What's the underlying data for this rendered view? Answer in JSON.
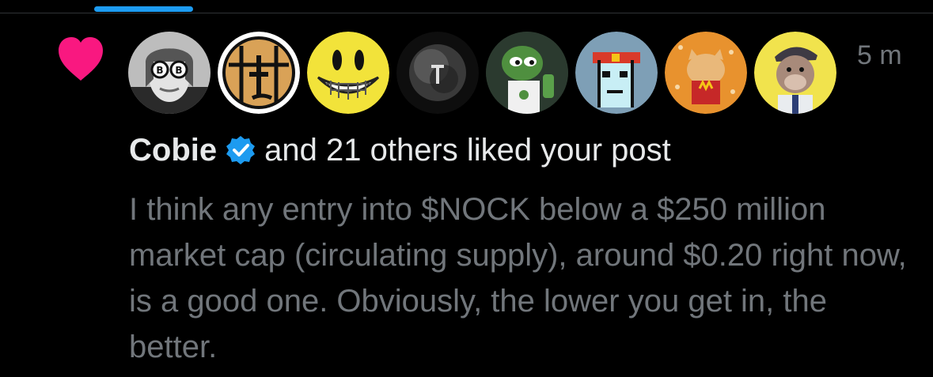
{
  "notification": {
    "type_icon": "heart-icon",
    "avatars": [
      {
        "name": "avatar-1"
      },
      {
        "name": "avatar-2"
      },
      {
        "name": "avatar-3"
      },
      {
        "name": "avatar-4"
      },
      {
        "name": "avatar-5"
      },
      {
        "name": "avatar-6"
      },
      {
        "name": "avatar-7"
      },
      {
        "name": "avatar-8"
      }
    ],
    "timestamp": "5 m",
    "liker_name": "Cobie",
    "liker_verified_icon": "verified-badge-icon",
    "summary_text": "and 21 others liked your post",
    "post_text": "I think any entry into $NOCK below a $250 million market cap (circulating supply), around $0.20 right now, is a good one. Obviously, the lower you get in, the better."
  },
  "colors": {
    "background": "#000000",
    "heart": "#f91880",
    "primary_text": "#e7e9ea",
    "secondary_text": "#71767b",
    "accent": "#1d9bf0"
  }
}
